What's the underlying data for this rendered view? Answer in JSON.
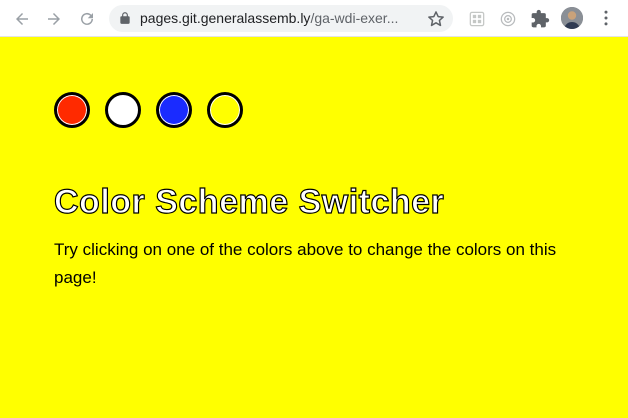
{
  "browser": {
    "back_icon": "arrow-left-icon",
    "forward_icon": "arrow-right-icon",
    "reload_icon": "reload-icon",
    "url_host": "pages.git.generalassemb.ly",
    "url_path": "/ga-wdi-exer..."
  },
  "page": {
    "background_color": "#ffff00",
    "swatches": [
      {
        "color": "#ff2a00"
      },
      {
        "color": "#ffffff"
      },
      {
        "color": "#1a2bff"
      },
      {
        "color": "#ffff00"
      }
    ],
    "title": "Color Scheme Switcher",
    "description": "Try clicking on one of the colors above to change the colors on this page!"
  }
}
